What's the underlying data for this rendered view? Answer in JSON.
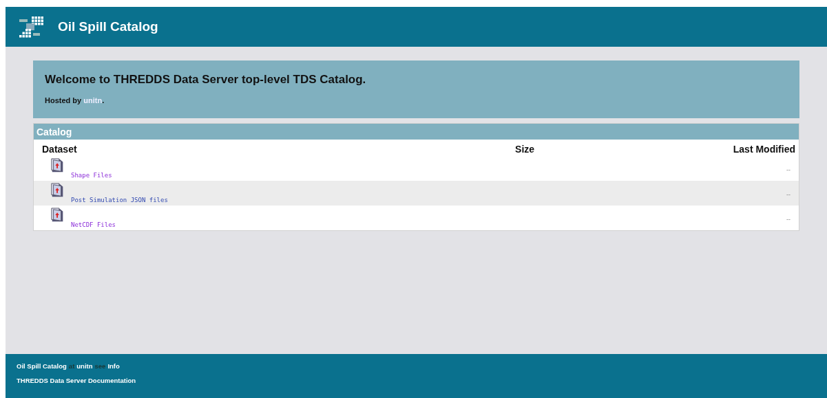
{
  "header": {
    "title": "Oil Spill Catalog"
  },
  "welcome": {
    "heading": "Welcome to THREDDS Data Server top-level TDS Catalog.",
    "hosted_prefix": "Hosted by ",
    "host_link": "unitn",
    "hosted_suffix": "."
  },
  "catalog": {
    "title": "Catalog",
    "columns": [
      "Dataset",
      "Size",
      "Last Modified"
    ],
    "rows": [
      {
        "name": "Shape Files",
        "modified": "--"
      },
      {
        "name": "Post Simulation JSON files",
        "modified": "--"
      },
      {
        "name": "NetCDF Files",
        "modified": "--"
      }
    ]
  },
  "footer": {
    "line_1": [
      {
        "kind": "link",
        "text": "Oil Spill Catalog"
      },
      {
        "kind": "text",
        "text": "at"
      },
      {
        "kind": "link",
        "text": "unitn"
      },
      {
        "kind": "text",
        "text": "see"
      },
      {
        "kind": "link",
        "text": "Info"
      }
    ],
    "line_2": [
      {
        "kind": "link",
        "text": "THREDDS Data Server Documentation"
      }
    ]
  }
}
